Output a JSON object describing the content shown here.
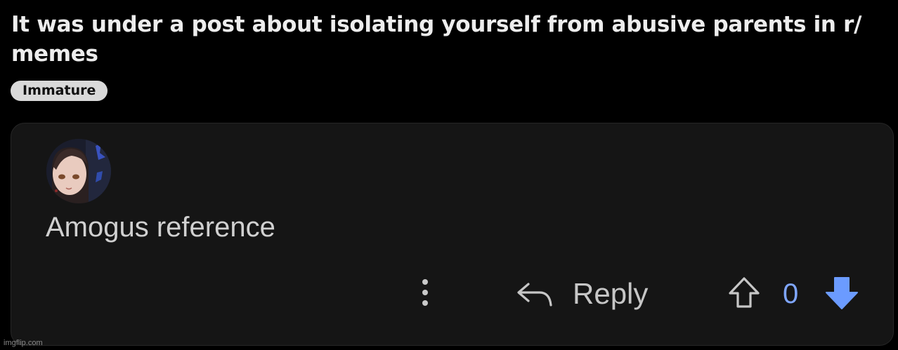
{
  "post": {
    "title": "It was under a post about isolating yourself from abusive parents in r/ memes",
    "flair": "Immature"
  },
  "comment": {
    "avatar_icon": "user-avatar-icon",
    "body": "Amogus reference",
    "actions": {
      "more_icon": "more-vertical-icon",
      "reply_icon": "reply-arrow-icon",
      "reply_label": "Reply",
      "upvote_icon": "upvote-arrow-outline-icon",
      "vote_count": "0",
      "downvote_icon": "downvote-arrow-filled-icon"
    }
  },
  "colors": {
    "background": "#000000",
    "card": "#151515",
    "flair_bg": "#d9d9d9",
    "vote_accent": "#7fa6ff"
  },
  "watermark": "imgflip.com"
}
